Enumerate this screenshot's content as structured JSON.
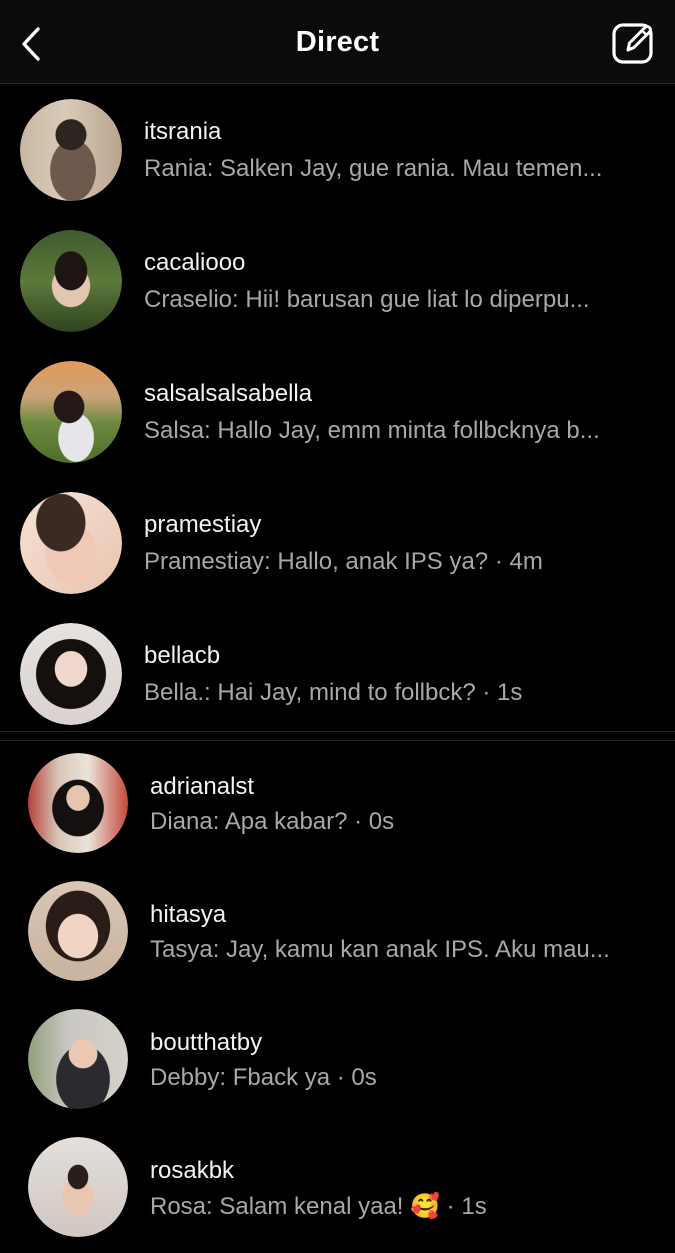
{
  "header": {
    "title": "Direct",
    "back_icon": "chevron-left-icon",
    "compose_icon": "compose-icon"
  },
  "threads": [
    {
      "username": "itsrania",
      "preview": "Rania: Salken Jay, gue rania. Mau temen..."
    },
    {
      "username": "cacaliooo",
      "preview": "Craselio: Hii! barusan gue liat lo diperpu..."
    },
    {
      "username": "salsalsalsabella",
      "preview": "Salsa: Hallo Jay, emm minta follbcknya b..."
    },
    {
      "username": "pramestiay",
      "preview": "Pramestiay: Hallo, anak IPS ya? · 4m"
    },
    {
      "username": "bellacb",
      "preview": "Bella.: Hai Jay, mind to follbck? · 1s"
    }
  ],
  "threads_2": [
    {
      "username": "adrianalst",
      "preview": "Diana: Apa kabar? · 0s"
    },
    {
      "username": "hitasya",
      "preview": "Tasya: Jay, kamu kan anak IPS. Aku mau..."
    },
    {
      "username": "boutthatby",
      "preview": "Debby: Fback ya · 0s"
    },
    {
      "username": "rosakbk",
      "preview": "Rosa: Salam kenal yaa! 🥰 · 1s"
    }
  ],
  "colors": {
    "background": "#000000",
    "header_bg": "#0b0b0b",
    "username": "#f2f2f2",
    "preview": "#a8a8a8"
  }
}
